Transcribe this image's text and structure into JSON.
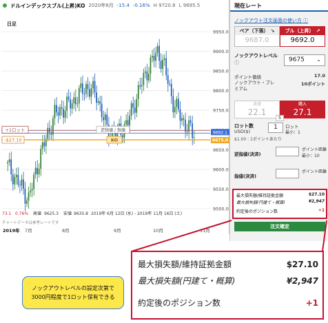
{
  "title_bar": {
    "instrument": "ドルインデックスブル(上昇)KO",
    "date": "2020年8月",
    "change": "-15.4",
    "change_pct": "-0.16%",
    "high": "H 9720.8",
    "low": "L 9695.5"
  },
  "chart": {
    "timeframe": "日足",
    "price_labels": [
      "9950.0",
      "9900.0",
      "9850.0",
      "9800.0",
      "9750.0",
      "9700.0",
      "9650.0",
      "9600.0",
      "9550.0",
      "9500.0"
    ],
    "current_price_tag": "9692.1",
    "ko_price_tag": "9675.0",
    "position_tag": "+1ロット",
    "pnl_tag": "-$27.10",
    "ko_tag": "KO",
    "order_tag": "逆指値 / 指値",
    "info_low": "73.1",
    "info_pct": "0.76%",
    "info_open_label": "高値",
    "info_open_val": "9625.3",
    "info_close_label": "安値",
    "info_close_val": "9635.8",
    "info_range": "2019年 6月 12日 (水) - 2019年 11月 16日 (土)",
    "info_source": "チャートデータは参考レートです",
    "x_labels": [
      "2019年",
      "7月",
      "8月",
      "9月",
      "10月",
      "11月"
    ],
    "line_colors": {
      "current": "#3a6fd8",
      "ko": "#e9a126",
      "position": "#a25656",
      "pnl": "#d68c38"
    }
  },
  "panel": {
    "tab": "現在レート",
    "help_link": "ノックアウト注文画面の使い方",
    "bear": {
      "label": "ベア（下落）",
      "arrow": "↘",
      "price": "9687.0"
    },
    "bull": {
      "label": "ブル（上昇）",
      "arrow": "↗",
      "price": "9692.0"
    },
    "ko_level_label": "ノックアウトレベル",
    "ko_level_value": "9675",
    "ko_chevron": "⌄",
    "point_value_label": "ポイント価値",
    "point_value": "17.0",
    "premium_label": "ノックアウト・プレミアム",
    "premium_value": "10ポイント",
    "bid_label": "決済",
    "bid_price": "22.1",
    "ask_label": "購入",
    "ask_price": "27.1",
    "spread": "5",
    "lot_label": "ロット数",
    "lot_currency": "USD($)",
    "lot_value": "1",
    "lot_unit": "ロット",
    "lot_min": "最小：1",
    "lot_info": "$1.00 : 1ポイントあたり",
    "stop_label": "逆指値(決済)",
    "stop_pip": "ポイント距離 最小：10",
    "limit_label": "指値(決済)",
    "limit_pip": "ポイント距離",
    "risk": {
      "max_loss_label": "最大損失額/維持証拠金額",
      "max_loss_value": "$27.10",
      "max_loss_jpy_label": "最大損失額(円建て・概算)",
      "max_loss_jpy_value": "¥2,947",
      "position_after_label": "約定後のポジション数",
      "position_after_value": "+1"
    },
    "confirm_button": "注文確定"
  },
  "zoom": {
    "max_loss_label": "最大損失額/維持証拠金額",
    "max_loss_value": "$27.10",
    "max_loss_jpy_label": "最大損失額(円建て・概算)",
    "max_loss_jpy_value": "¥2,947",
    "position_after_label": "約定後のポジション数",
    "position_after_value": "+1"
  },
  "note": {
    "line1": "ノックアウトレベルの設定次第で",
    "line2": "3000円程度で1ロット保有できる"
  },
  "colors": {
    "up": "#2e7d32",
    "down": "#1f5fbf",
    "accent_red": "#c61f2c",
    "highlight": "#fde84a"
  }
}
